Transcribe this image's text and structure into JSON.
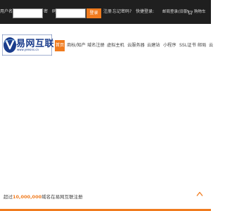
{
  "topbar": {
    "username_label": "用户名:",
    "password_label": "密　码:",
    "login_button": "登录",
    "register_link": "注册",
    "forgot_link": "忘记密码?",
    "quick_login_label": "快捷登录:",
    "mailbox_link": "邮局登录(旧版)",
    "cart_label": "购物车"
  },
  "logo": {
    "name": "易网互联",
    "url": "www.yeeons.cn"
  },
  "nav": {
    "items": [
      {
        "label": "首页"
      },
      {
        "label": "商标/知产"
      },
      {
        "label": "域名注册"
      },
      {
        "label": "虚拟主机"
      },
      {
        "label": "云服务器"
      },
      {
        "label": "云建站"
      },
      {
        "label": "小程序"
      },
      {
        "label": "SSL证书"
      },
      {
        "label": "邮局"
      },
      {
        "label": "云"
      }
    ]
  },
  "tagline": {
    "prefix": "超过",
    "number": "10,000,000",
    "suffix": "域名在易网互联注册"
  },
  "colors": {
    "topbar_bg": "#1f1f1f",
    "accent": "#f07b1e",
    "brand_blue": "#1a3c8c"
  }
}
